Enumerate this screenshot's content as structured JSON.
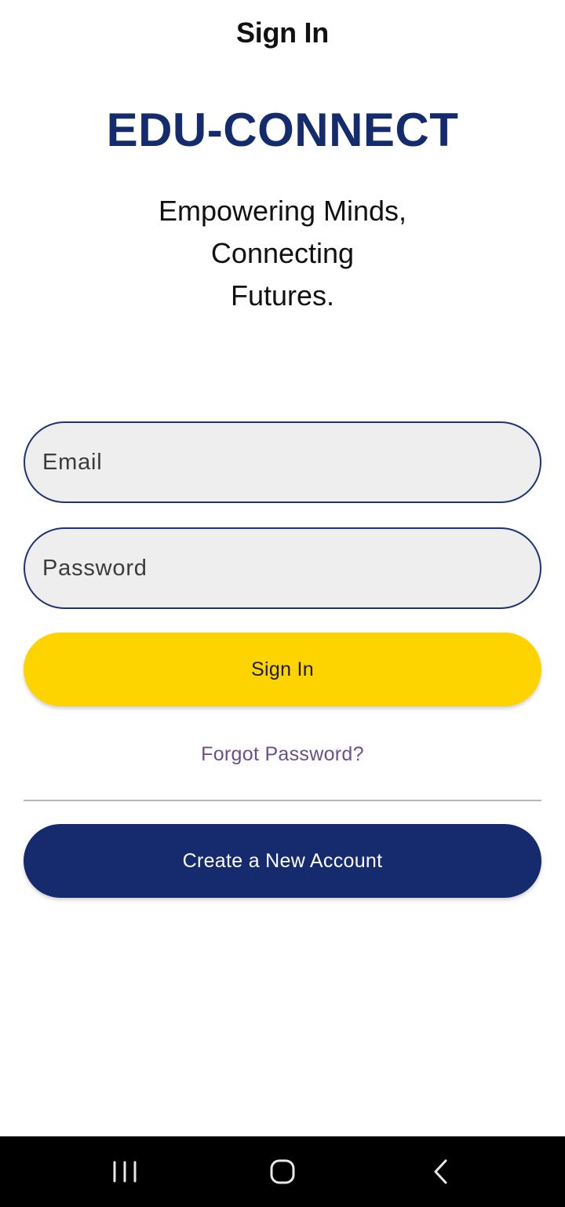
{
  "header": {
    "title": "Sign In"
  },
  "brand": {
    "name": "EDU-CONNECT",
    "tagline": [
      "Empowering Minds,",
      "Connecting",
      "Futures."
    ]
  },
  "form": {
    "email_placeholder": "Email",
    "email_value": "",
    "password_placeholder": "Password",
    "password_value": "",
    "sign_in_label": "Sign In",
    "forgot_password_label": "Forgot Password?",
    "create_account_label": "Create a New Account"
  },
  "navigation_bar": {
    "buttons": [
      "recents-icon",
      "home-icon",
      "back-icon"
    ]
  },
  "colors": {
    "brand_navy": "#152b6e",
    "sign_in_yellow": "#fdd400",
    "field_background": "#eeeeee",
    "forgot_link": "#6a4f8c"
  }
}
